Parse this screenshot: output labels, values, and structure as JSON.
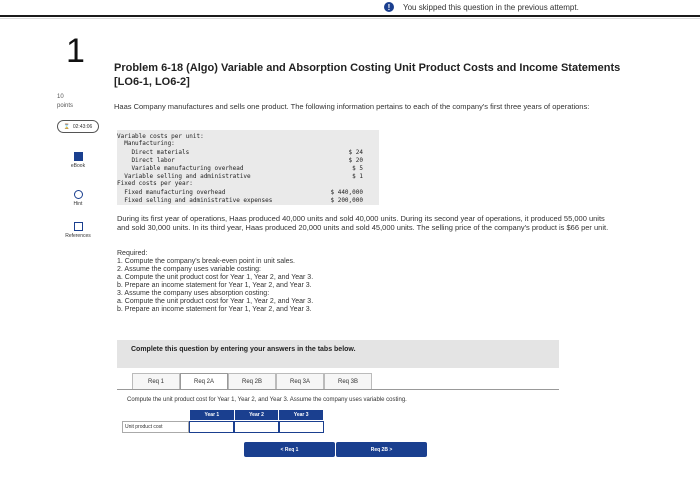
{
  "banner": {
    "icon": "!",
    "text": "You skipped this question in the previous attempt."
  },
  "sidebar": {
    "question_number": "1",
    "points_value": "10",
    "points_label": "points",
    "timer": "02:43:06",
    "tools": [
      {
        "label": "eBook",
        "icon": "book-icon"
      },
      {
        "label": "Hint",
        "icon": "hint-icon"
      },
      {
        "label": "References",
        "icon": "references-icon"
      }
    ]
  },
  "problem": {
    "title": "Problem 6-18 (Algo) Variable and Absorption Costing Unit Product Costs and Income Statements [LO6-1, LO6-2]",
    "intro": "Haas Company manufactures and sells one product. The following information pertains to each of the company's first three years of operations:",
    "cost_table": [
      {
        "label": "Variable costs per unit:",
        "value": ""
      },
      {
        "label": "  Manufacturing:",
        "value": ""
      },
      {
        "label": "    Direct materials",
        "value": "$ 24"
      },
      {
        "label": "    Direct labor",
        "value": "$ 20"
      },
      {
        "label": "    Variable manufacturing overhead",
        "value": "$ 5"
      },
      {
        "label": "  Variable selling and administrative",
        "value": "$ 1"
      },
      {
        "label": "Fixed costs per year:",
        "value": ""
      },
      {
        "label": "  Fixed manufacturing overhead",
        "value": "$ 440,000"
      },
      {
        "label": "  Fixed selling and administrative expenses",
        "value": "$ 200,000"
      }
    ],
    "operations_text": "During its first year of operations, Haas produced 40,000 units and sold 40,000 units. During its second year of operations, it produced 55,000 units and sold 30,000 units. In its third year, Haas produced 20,000 units and sold 45,000 units. The selling price of the company's product is $66 per unit.",
    "required_heading": "Required:",
    "required_items": [
      "1. Compute the company's break-even point in unit sales.",
      "2. Assume the company uses variable costing:",
      "a. Compute the unit product cost for Year 1, Year 2, and Year 3.",
      "b. Prepare an income statement for Year 1, Year 2, and Year 3.",
      "3. Assume the company uses absorption costing:",
      "a. Compute the unit product cost for Year 1, Year 2, and Year 3.",
      "b. Prepare an income statement for Year 1, Year 2, and Year 3."
    ]
  },
  "answer": {
    "instruction": "Complete this question by entering your answers in the tabs below.",
    "tabs": [
      "Req 1",
      "Req 2A",
      "Req 2B",
      "Req 3A",
      "Req 3B"
    ],
    "active_tab": "Req 2A",
    "tab_instruction": "Compute the unit product cost for Year 1, Year 2, and Year 3. Assume the company uses variable costing.",
    "table": {
      "headers": [
        "Year 1",
        "Year 2",
        "Year 3"
      ],
      "row_label": "Unit product cost",
      "values": [
        "",
        "",
        ""
      ]
    },
    "prev_button": "< Req 1",
    "next_button": "Req 2B >"
  }
}
